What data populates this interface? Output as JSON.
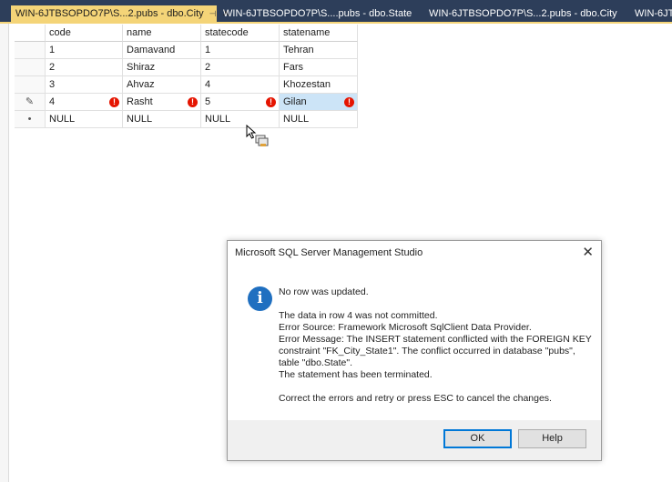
{
  "tabs": [
    {
      "label": "WIN-6JTBSOPDO7P\\S...2.pubs - dbo.City",
      "active": true,
      "pin": "⊣",
      "close": "✕"
    },
    {
      "label": "WIN-6JTBSOPDO7P\\S....pubs - dbo.State",
      "active": false
    },
    {
      "label": "WIN-6JTBSOPDO7P\\S...2.pubs - dbo.City",
      "active": false
    },
    {
      "label": "WIN-6JT",
      "active": false
    }
  ],
  "grid": {
    "columns": [
      "code",
      "name",
      "statecode",
      "statename"
    ],
    "rows": [
      {
        "indicator": "",
        "code": "1",
        "name": "Damavand",
        "statecode": "1",
        "statename": "Tehran"
      },
      {
        "indicator": "",
        "code": "2",
        "name": "Shiraz",
        "statecode": "2",
        "statename": "Fars"
      },
      {
        "indicator": "",
        "code": "3",
        "name": "Ahvaz",
        "statecode": "4",
        "statename": "Khozestan"
      },
      {
        "indicator": "✎",
        "code": "4",
        "name": "Rasht",
        "statecode": "5",
        "statename": "Gilan"
      },
      {
        "indicator": "•",
        "code": "NULL",
        "name": "NULL",
        "statecode": "NULL",
        "statename": "NULL"
      }
    ],
    "error_glyph": "!"
  },
  "dialog": {
    "title": "Microsoft SQL Server Management Studio",
    "close": "✕",
    "icon": "i",
    "heading": "No row was updated.",
    "lines": [
      "The data in row 4 was not committed.",
      "Error Source: Framework Microsoft SqlClient Data Provider.",
      "Error Message: The INSERT statement conflicted with the FOREIGN KEY",
      "constraint \"FK_City_State1\". The conflict occurred in database \"pubs\",",
      "table \"dbo.State\".",
      "The statement has been terminated."
    ],
    "footer_text": "Correct the errors and retry or press ESC to cancel the changes.",
    "ok_label": "OK",
    "help_label": "Help"
  },
  "colors": {
    "tabbar_bg": "#2d3e5a",
    "active_tab": "#f4d478",
    "error_badge": "#e51400",
    "info_icon": "#1f6fc0",
    "selected_cell": "#cce4f7"
  }
}
